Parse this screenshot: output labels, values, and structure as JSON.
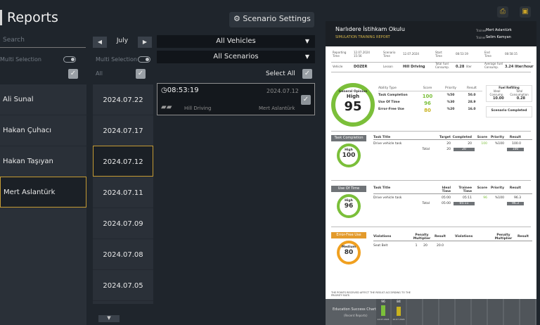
{
  "header": {
    "title": "Reports",
    "settings_label": "Scenario Settings"
  },
  "left": {
    "search_placeholder": "Search",
    "multi_selection": "Multi Selection",
    "users": [
      "Ali Sunal",
      "Hakan Çuhacı",
      "Hakan Taşıyan",
      "Mert Aslantürk"
    ],
    "selected_user": "Mert Aslantürk"
  },
  "dates": {
    "month": "July",
    "multi_selection": "Multi Selection",
    "all": "All",
    "items": [
      "2024.07.22",
      "2024.07.17",
      "2024.07.12",
      "2024.07.11",
      "2024.07.09",
      "2024.07.08",
      "2024.07.05"
    ],
    "selected": "2024.07.12"
  },
  "filters": {
    "vehicle": "All Vehicles",
    "scenario": "All Scenarios",
    "select_all": "Select All"
  },
  "session": {
    "time": "08:53:19",
    "date": "2024.07.12",
    "lesson": "Hill Driving",
    "user": "Mert Aslantürk"
  },
  "report": {
    "school": "Narlıdere İstihkam Okulu",
    "subtitle": "SIMULATION TRAINING REPORT",
    "trainee_label": "Trainee",
    "trainee": "Mert Aslantürk",
    "trainer_label": "Trainer",
    "trainer": "Selim Kamyan",
    "info": [
      [
        "Reporting Time",
        "12.07.2024 15:56"
      ],
      [
        "Scenario Time",
        "12.07.2024"
      ],
      [
        "Start Time",
        "08:53:19"
      ],
      [
        "End Time",
        "08:58:15"
      ]
    ],
    "vehicle_label": "Vehicle",
    "vehicle": "DOZER",
    "lesson_label": "Lesson",
    "lesson": "Hill Driving",
    "fuel_label": "Total Fuel Consump.",
    "fuel": "0.28",
    "fuel_unit": "liter",
    "avg_fuel_label": "Average Fuel Consump.",
    "avg_fuel": "3.24 liter/hour",
    "general": {
      "label": "General Opinion",
      "level": "High",
      "score": "95"
    },
    "ability_table": {
      "headers": [
        "Ability Type",
        "Score",
        "Priority",
        "Result"
      ],
      "rows": [
        [
          "Task Completion",
          "100",
          "%50",
          "50.0"
        ],
        [
          "Use Of Time",
          "96",
          "%30",
          "28.9"
        ],
        [
          "Error-Free Use",
          "80",
          "%20",
          "16.0"
        ]
      ]
    },
    "fuel_box": {
      "title": "Fuel Refilling",
      "ideal_label": "Ideal Consump.",
      "ideal": "10.00",
      "total_label": "Total Consumption",
      "total": "0.28"
    },
    "scenario_completed": "Scenario Completed",
    "task": {
      "label": "Task Completion",
      "level": "High",
      "score": "100",
      "headers": [
        "Task Title",
        "Target",
        "Completed",
        "Score",
        "Priority",
        "Result"
      ],
      "row": [
        "Drive vehicle task",
        "20",
        "20",
        "100",
        "%100",
        "100.0"
      ],
      "total_label": "Total",
      "total": [
        "20",
        "20",
        "100"
      ]
    },
    "time": {
      "label": "Use Of Time",
      "level": "High",
      "score": "96",
      "headers": [
        "Task Title",
        "Ideal Time",
        "Trainee Time",
        "Score",
        "Priority",
        "Result"
      ],
      "row": [
        "Drive vehicle task",
        "05:00",
        "05:11",
        "96",
        "%100",
        "96.3"
      ],
      "total_label": "Total",
      "total": [
        "05:00",
        "05:11",
        "96.3"
      ]
    },
    "error": {
      "label": "Error-Free Use",
      "level": "Medium",
      "score": "80",
      "headers": [
        "Violations",
        "Penalty Multiplier",
        "Result",
        "Violations",
        "Penalty Multiplier",
        "Result"
      ],
      "row": [
        "Seat Belt",
        "1",
        "20",
        "20.0"
      ]
    },
    "note": "THE POINTS RECEIVED AFFECT THE RESULT ACCORDING TO THE PRIORITY RATE.",
    "footer": {
      "chart_label": "Education Success Chart",
      "chart_sub": "(Recent Reports)",
      "bars": [
        {
          "value": "96",
          "date": "12.07.2024"
        },
        {
          "value": "84",
          "date": "10.07.2024"
        }
      ]
    }
  },
  "colors": {
    "accent": "#c59b33",
    "good": "#7bbf3a",
    "medium": "#f0a020"
  }
}
